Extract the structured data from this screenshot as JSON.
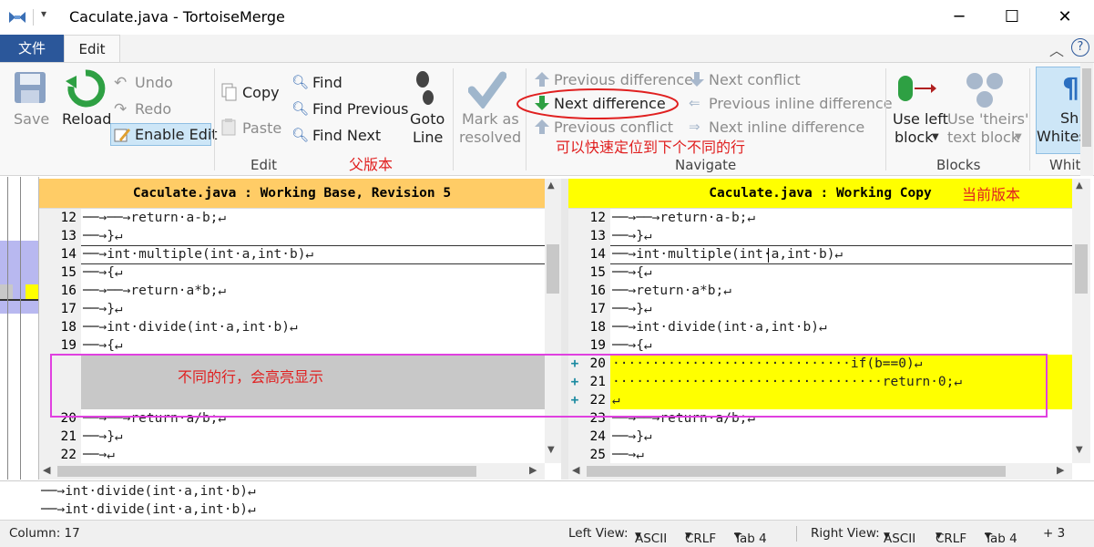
{
  "window": {
    "title": "Caculate.java - TortoiseMerge",
    "minimize": "─",
    "maximize": "☐",
    "close": "✕"
  },
  "tabs": {
    "file": "文件",
    "edit": "Edit"
  },
  "ribbon": {
    "save": "Save",
    "reload": "Reload",
    "undo": "Undo",
    "redo": "Redo",
    "enable_edit": "Enable Edit",
    "copy": "Copy",
    "paste": "Paste",
    "edit_group": "Edit",
    "find": "Find",
    "find_previous": "Find Previous",
    "find_next": "Find Next",
    "goto_line_1": "Goto",
    "goto_line_2": "Line",
    "mark_resolved_1": "Mark as",
    "mark_resolved_2": "resolved",
    "previous_difference": "Previous difference",
    "next_difference": "Next difference",
    "previous_conflict": "Previous conflict",
    "next_conflict": "Next conflict",
    "previous_inline_difference": "Previous inline difference",
    "next_inline_difference": "Next inline difference",
    "navigate_group": "Navigate",
    "use_left_block_1": "Use left",
    "use_left_block_2": "block",
    "use_theirs_block_1": "Use 'theirs'",
    "use_theirs_block_2": "text block",
    "blocks_group": "Blocks",
    "whitespace_1": "Sh",
    "whitespace_2": "Whites",
    "whitespace_group": "Whit"
  },
  "annotations": {
    "base_version": "父版本",
    "next_diff_note": "可以快速定位到下个不同的行",
    "current_version": "当前版本",
    "diff_highlight_note": "不同的行，会高亮显示"
  },
  "left_pane": {
    "header": "Caculate.java : Working Base, Revision 5",
    "lines": [
      {
        "num": "12",
        "code": "──→──→return·a-b;↵"
      },
      {
        "num": "13",
        "code": "──→}↵"
      },
      {
        "num": "14",
        "code": "──→int·multiple(int·a,int·b)↵"
      },
      {
        "num": "15",
        "code": "──→{↵"
      },
      {
        "num": "16",
        "code": "──→──→return·a*b;↵"
      },
      {
        "num": "17",
        "code": "──→}↵"
      },
      {
        "num": "18",
        "code": "──→int·divide(int·a,int·b)↵"
      },
      {
        "num": "19",
        "code": "──→{↵"
      },
      {
        "num": "",
        "code": ""
      },
      {
        "num": "",
        "code": ""
      },
      {
        "num": "",
        "code": ""
      },
      {
        "num": "20",
        "code": "──→──→return·a/b;↵"
      },
      {
        "num": "21",
        "code": "──→}↵"
      },
      {
        "num": "22",
        "code": "──→↵"
      }
    ]
  },
  "right_pane": {
    "header": "Caculate.java : Working Copy",
    "lines": [
      {
        "mark": "",
        "num": "12",
        "code": "──→──→return·a-b;↵"
      },
      {
        "mark": "",
        "num": "13",
        "code": "──→}↵"
      },
      {
        "mark": "",
        "num": "14",
        "code": "──→int·multiple(int·a,int·b)↵"
      },
      {
        "mark": "",
        "num": "15",
        "code": "──→{↵"
      },
      {
        "mark": "",
        "num": "16",
        "code": "──→return·a*b;↵"
      },
      {
        "mark": "",
        "num": "17",
        "code": "──→}↵"
      },
      {
        "mark": "",
        "num": "18",
        "code": "──→int·divide(int·a,int·b)↵"
      },
      {
        "mark": "",
        "num": "19",
        "code": "──→{↵"
      },
      {
        "mark": "+",
        "num": "20",
        "code": "······························if(b==0)↵"
      },
      {
        "mark": "+",
        "num": "21",
        "code": "··································return·0;↵"
      },
      {
        "mark": "+",
        "num": "22",
        "code": "↵"
      },
      {
        "mark": "",
        "num": "23",
        "code": "──→──→return·a/b;↵"
      },
      {
        "mark": "",
        "num": "24",
        "code": "──→}↵"
      },
      {
        "mark": "",
        "num": "25",
        "code": "──→↵"
      }
    ]
  },
  "bottom_compare": {
    "line1": "──→int·divide(int·a,int·b)↵",
    "line2": "──→int·divide(int·a,int·b)↵"
  },
  "status": {
    "column": "Column: 17",
    "left_view_label": "Left View:",
    "left_encoding": "ASCII",
    "left_eol": "CRLF",
    "left_tab": "Tab 4",
    "right_view_label": "Right View:",
    "right_encoding": "ASCII",
    "right_eol": "CRLF",
    "right_tab": "Tab 4",
    "right_extra": "+ 3"
  },
  "colors": {
    "left_header_bg": "#ffcc66",
    "right_header_bg": "#ffff00",
    "added_bg": "#ffff00",
    "missing_bg": "#c8c8c8",
    "annotation": "#e02020",
    "highlight_box": "#e040e0"
  }
}
